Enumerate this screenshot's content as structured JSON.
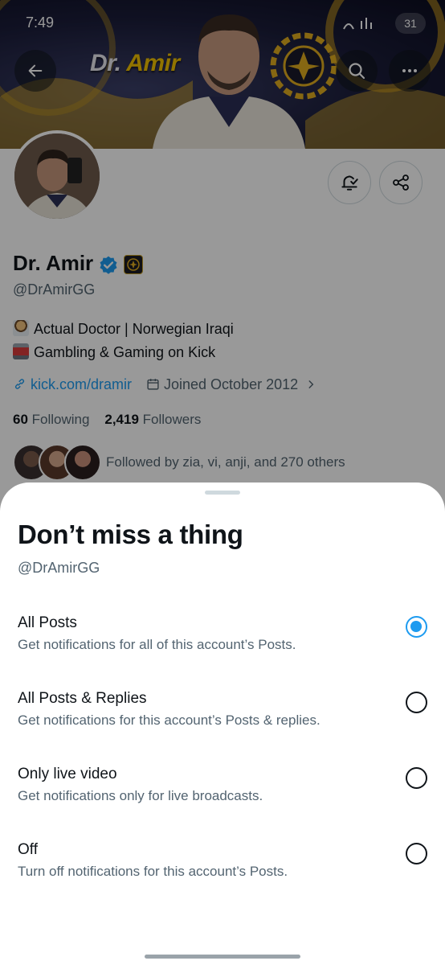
{
  "status_bar": {
    "time": "7:49",
    "battery": "31"
  },
  "banner": {
    "brand_prefix": "Dr.",
    "brand_name": "Amir"
  },
  "profile": {
    "display_name": "Dr. Amir",
    "handle": "@DrAmirGG",
    "bio": [
      {
        "emoji": "man-health-worker-emoji",
        "text": "Actual Doctor | Norwegian Iraqi"
      },
      {
        "emoji": "slot-machine-emoji",
        "text": "Gambling & Gaming on Kick"
      }
    ],
    "link": "kick.com/dramir",
    "joined": "Joined October 2012",
    "following_count": "60",
    "following_label": "Following",
    "followers_count": "2,419",
    "followers_label": "Followers",
    "followed_by": "Followed by zia, vi, anji, and 270 others"
  },
  "sheet": {
    "title": "Don’t miss a thing",
    "subtitle": "@DrAmirGG",
    "options": [
      {
        "title": "All Posts",
        "description": "Get notifications for all of this account’s Posts.",
        "selected": true
      },
      {
        "title": "All Posts & Replies",
        "description": "Get notifications for this account’s Posts & replies.",
        "selected": false
      },
      {
        "title": "Only live video",
        "description": "Get notifications only for live broadcasts.",
        "selected": false
      },
      {
        "title": "Off",
        "description": "Turn off notifications for this account’s Posts.",
        "selected": false
      }
    ]
  },
  "colors": {
    "accent": "#1d9bf0",
    "text": "#0f1419",
    "secondary": "#536471",
    "brand_gold": "#f2c200"
  }
}
